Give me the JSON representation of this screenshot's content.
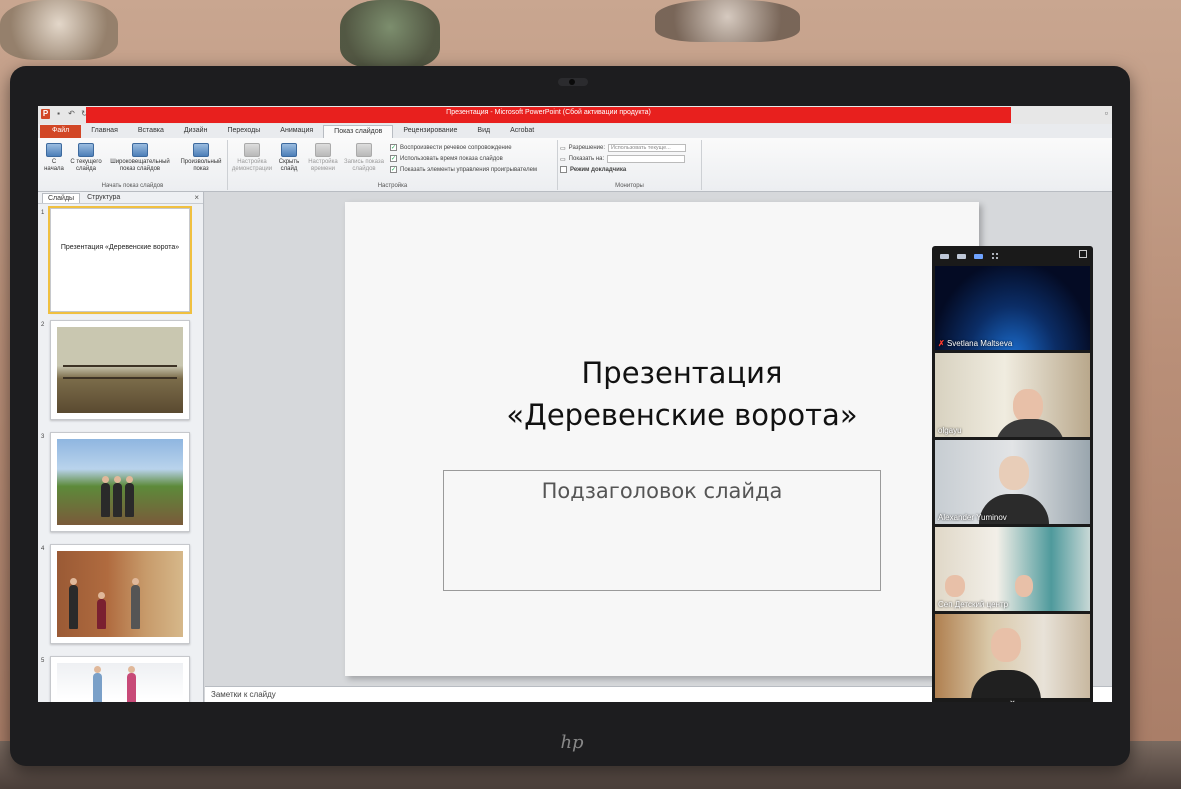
{
  "window": {
    "title": "Презентация - Microsoft PowerPoint (Сбой активации продукта)"
  },
  "ribbon": {
    "tabs": [
      "Файл",
      "Главная",
      "Вставка",
      "Дизайн",
      "Переходы",
      "Анимация",
      "Показ слайдов",
      "Рецензирование",
      "Вид",
      "Acrobat"
    ],
    "active_tab": "Показ слайдов",
    "group_start": {
      "label": "Начать показ слайдов",
      "from_beginning": "С начала",
      "from_current": "С текущего слайда",
      "broadcast": "Широковещательный показ слайдов",
      "custom": "Произвольный показ"
    },
    "group_setup": {
      "label": "Настройка",
      "setup_show": "Настройка демонстрации",
      "hide_slide": "Скрыть слайд",
      "rehearse": "Настройка времени",
      "record": "Запись показа слайдов",
      "chk_narration": "Воспроизвести речевое сопровождение",
      "chk_timings": "Использовать время показа слайдов",
      "chk_media": "Показать элементы управления проигрывателем"
    },
    "group_monitors": {
      "label": "Мониторы",
      "resolution_label": "Разрешение:",
      "resolution_value": "Использовать текуще...",
      "show_on_label": "Показать на:",
      "presenter_view": "Режим докладчика"
    }
  },
  "slides_pane": {
    "tabs": [
      "Слайды",
      "Структура"
    ],
    "active_tab": "Слайды",
    "close": "×",
    "slides": [
      {
        "num": "1",
        "title": "Презентация «Деревенские ворота»"
      },
      {
        "num": "2"
      },
      {
        "num": "3"
      },
      {
        "num": "4"
      },
      {
        "num": "5"
      }
    ]
  },
  "slide": {
    "title_line1": "Презентация",
    "title_line2": "«Деревенские ворота»",
    "subtitle": "Подзаголовок слайда"
  },
  "notes": {
    "placeholder": "Заметки к слайду"
  },
  "video_call": {
    "participants": [
      {
        "name": "Svetlana Maltseva",
        "muted": true
      },
      {
        "name": "olgayu"
      },
      {
        "name": "Alexander Yuminov"
      },
      {
        "name": "Сеп Детский центр"
      },
      {
        "name": ""
      }
    ],
    "more": "⌄"
  },
  "monitor": {
    "brand": "hp"
  }
}
